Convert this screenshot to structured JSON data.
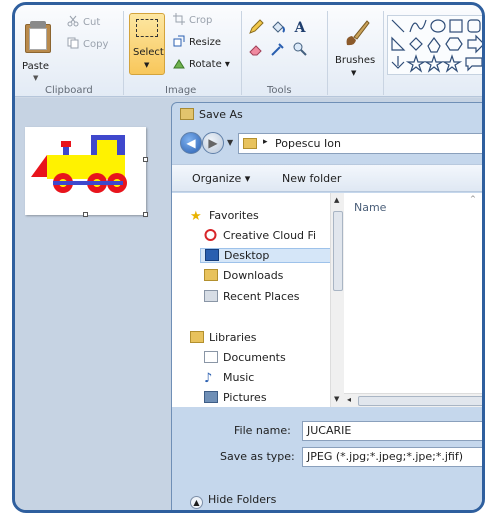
{
  "ribbon": {
    "clipboard": {
      "paste_label": "Paste",
      "cut_label": "Cut",
      "copy_label": "Copy",
      "group_label": "Clipboard"
    },
    "image": {
      "select_label": "Select",
      "crop_label": "Crop",
      "resize_label": "Resize",
      "rotate_label": "Rotate",
      "group_label": "Image"
    },
    "tools": {
      "group_label": "Tools"
    },
    "brushes_label": "Brushes"
  },
  "canvas": {
    "colors": {
      "red": "#e8141c",
      "yellow": "#fff200",
      "blue": "#3f48cc"
    }
  },
  "dialog": {
    "title": "Save As",
    "breadcrumb": "Popescu Ion",
    "toolbar": {
      "organize_label": "Organize",
      "new_folder_label": "New folder"
    },
    "nav": {
      "favorites_label": "Favorites",
      "items": [
        "Creative Cloud Fi",
        "Desktop",
        "Downloads",
        "Recent Places"
      ],
      "libraries_label": "Libraries",
      "library_items": [
        "Documents",
        "Music",
        "Pictures"
      ]
    },
    "column_name": "Name",
    "file_name_label": "File name:",
    "file_name_value": "JUCARIE",
    "save_type_label": "Save as type:",
    "save_type_value": "JPEG (*.jpg;*.jpeg;*.jpe;*.jfif)",
    "hide_folders_label": "Hide Folders"
  }
}
